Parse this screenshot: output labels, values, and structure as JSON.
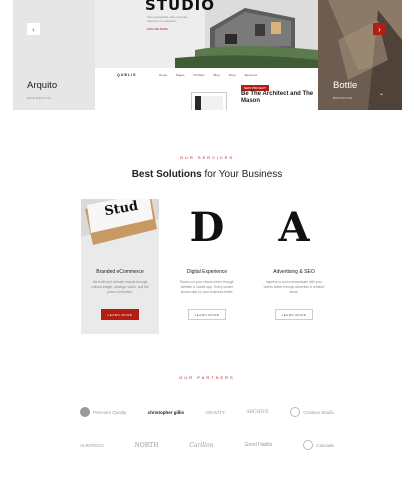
{
  "carousel": {
    "left": {
      "title": "Arquito",
      "subtitle": "Residential"
    },
    "main": {
      "hero_word": "STUDIO",
      "hero_small": "Sed ut perspiciatis unde omnis iste natus error sit voluptatem",
      "hero_link": "Explore more",
      "logo": "QUBLIS",
      "nav": [
        "Home",
        "Pages",
        "Portfolio",
        "Blog",
        "Shop",
        "Elements"
      ],
      "badge": "New Project",
      "headline": "Be The Architect and The Mason"
    },
    "right": {
      "title": "Bottle",
      "subtitle": "Branding"
    },
    "prev_icon": "‹",
    "next_icon": "›",
    "scroll_icon": "⌄"
  },
  "services": {
    "eyebrow": "Our Services",
    "title_bold": "Best Solutions",
    "title_rest": " for Your Business",
    "cards": [
      {
        "name": "Branded eCommerce",
        "desc": "We build and unleash brands through cultural insight, strategic vision, and the power of emotion.",
        "button": "Learn more",
        "media_text": "Stud"
      },
      {
        "letter": "D",
        "name": "Digital Experience",
        "desc": "Reach out your clients better through website & mobile app. Every screen across skip for your business better.",
        "button": "Learn more"
      },
      {
        "letter": "A",
        "name": "Advertising & SEO",
        "desc": "Impress to and communicate with your clients better through Advertise & creative ideas.",
        "button": "Learn more"
      }
    ]
  },
  "partners": {
    "eyebrow": "Our Partners",
    "row1": [
      "Premium Quality",
      "christopher gillis",
      "GRAVITY",
      "ARCHIVE",
      "Creative Studio"
    ],
    "row2": [
      "ALRATECH",
      "NORTH",
      "Carillon",
      "Good Habits",
      "Cascade"
    ]
  },
  "colors": {
    "accent": "#b21e14",
    "card_bg": "#eaeaea",
    "muted": "#888888"
  }
}
